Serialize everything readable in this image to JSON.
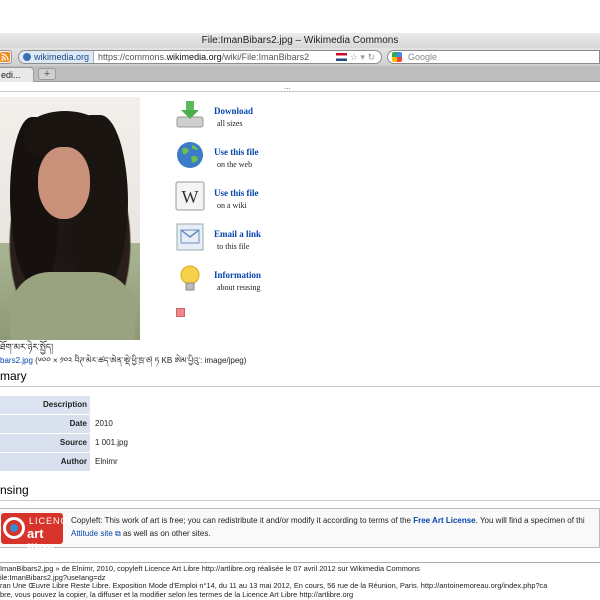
{
  "window": {
    "title": "File:ImanBibars2.jpg – Wikimedia Commons"
  },
  "navbar": {
    "site_identity": "wikimedia.org",
    "url_prefix": "https://commons.",
    "url_domain": "wikimedia.org",
    "url_path": "/wiki/File:ImanBibars2",
    "search_placeholder": "Google"
  },
  "tabs": [
    {
      "label": "edi..."
    }
  ],
  "page": {
    "top_fragment": "...",
    "caption_line1": "ཐོག་མར་ཉེར་སྤྱོད།",
    "caption_link": "bars2.jpg",
    "caption_details": " (༦༠༠ × ༡༠༢ བིཊ་མེར་ཚད་ཨེན་ཨྡེ་ཕྱི་ཁྲ་ཙ། ཏ KB ཨེམ་པྱིའུ་: image/jpeg)",
    "actions": [
      {
        "title": "Download",
        "subtitle": "all sizes",
        "icon": "download-icon"
      },
      {
        "title": "Use this file",
        "subtitle": "on the web",
        "icon": "globe-icon"
      },
      {
        "title": "Use this file",
        "subtitle": "on a wiki",
        "icon": "wikipedia-icon"
      },
      {
        "title": "Email a link",
        "subtitle": "to this file",
        "icon": "email-icon"
      },
      {
        "title": "Information",
        "subtitle": "about reusing",
        "icon": "lightbulb-icon"
      }
    ],
    "summary_heading": "mary",
    "summary_rows": [
      {
        "key": "Description",
        "value": ""
      },
      {
        "key": "Date",
        "value": "2010"
      },
      {
        "key": "Source",
        "value": "1 001.jpg"
      },
      {
        "key": "Author",
        "value": "Elnimr"
      }
    ],
    "licensing_heading": "nsing",
    "licence": {
      "logo_line1": "LICENCE",
      "logo_line2": "art libre",
      "text_a": "Copyleft: This work of art is free; you can redistribute it and/or modify it according to terms of the ",
      "link_a": "Free Art License",
      "text_b": ". You will find a specimen of thi",
      "link_b": "Attitude site",
      "text_c": " as well as on other sites."
    }
  },
  "status": {
    "line1": "ImanBibars2.jpg » de Elnimr, 2010, copyleft Licence Art Libre http://artlibre.org réalisée le 07 avril 2012 sur Wikimedia Commons",
    "line2": "ile:ImanBibars2.jpg?useIang=dz",
    "line3": "ran Une Œuvre Libre Reste Libre. Exposition Mode d'Emploi n°14, du 11 au 13 mai 2012, En cours, 56 rue de la Réunion, Paris. http://antoinemoreau.org/index.php?ca",
    "line4": "bre, vous pouvez la copier, la diffuser et la modifier selon les termes de la Licence Art Libre http://artlibre.org"
  }
}
